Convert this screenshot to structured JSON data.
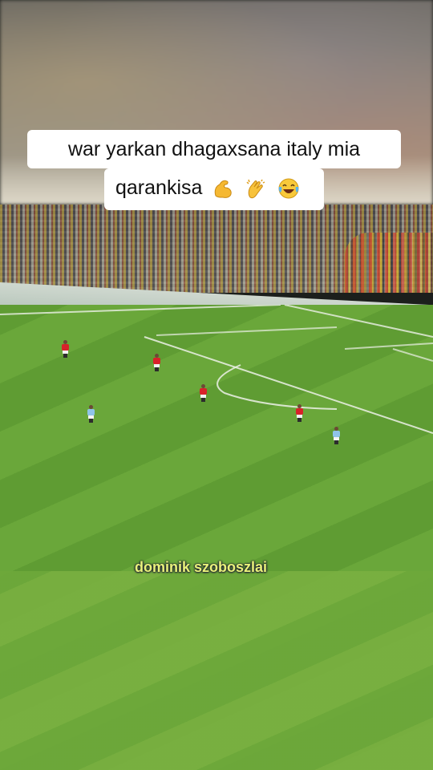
{
  "caption": {
    "line1": "war yarkan dhagaxsana italy mia",
    "line2": "qarankisa",
    "emojis": [
      "flexed-biceps-icon",
      "clapping-hands-icon",
      "tears-of-joy-icon"
    ]
  },
  "player_name": "dominik szoboszlai",
  "colors": {
    "pitch": "#6aa73a",
    "name_text": "#e9f27a",
    "red_team": "#d8222a",
    "blue_team": "#8fc4e8"
  }
}
